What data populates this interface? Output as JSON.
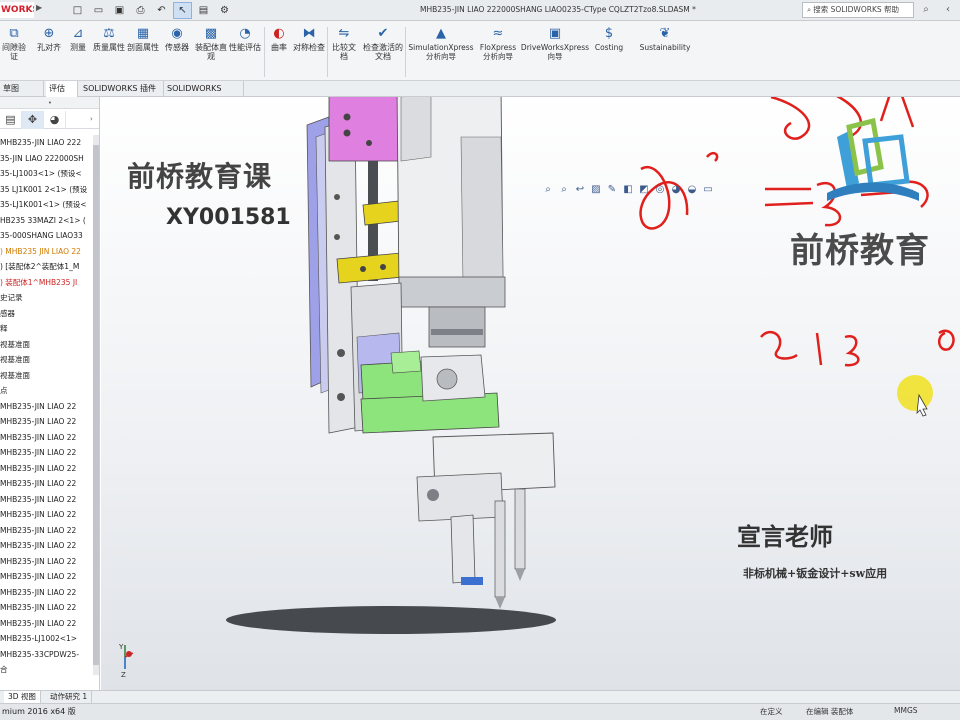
{
  "app": {
    "logo_text": "WORKS"
  },
  "title_bar": {
    "document_title": "MHB235-JIN LIAO 222000SHANG LIAO0235-CType CQLZT2Tzo8.SLDASM *",
    "help_search_placeholder": "搜索 SOLIDWORKS 帮助"
  },
  "quick_access": [
    "new-icon",
    "open-icon",
    "save-icon",
    "print-icon",
    "undo-icon",
    "select-icon",
    "file-properties-icon",
    "options-icon"
  ],
  "ribbon": {
    "buttons": [
      {
        "label": "间隙验证",
        "icon": "clearance-icon"
      },
      {
        "label": "孔对齐",
        "icon": "hole-align-icon"
      },
      {
        "label": "测量",
        "icon": "measure-icon"
      },
      {
        "label": "质量属性",
        "icon": "mass-properties-icon"
      },
      {
        "label": "剖面属性",
        "icon": "section-properties-icon"
      },
      {
        "label": "传感器",
        "icon": "sensor-icon"
      },
      {
        "label": "装配体直观",
        "icon": "assembly-visual-icon"
      },
      {
        "label": "性能评估",
        "icon": "performance-icon"
      },
      {
        "label": "曲率",
        "icon": "curvature-icon"
      },
      {
        "label": "对称检查",
        "icon": "symmetry-icon"
      },
      {
        "label": "比较文档",
        "icon": "compare-icon"
      },
      {
        "label": "检查激活的文档",
        "icon": "check-document-icon"
      },
      {
        "label": "SimulationXpress 分析向导",
        "icon": "simulation-icon"
      },
      {
        "label": "FloXpress 分析向导",
        "icon": "floxpress-icon"
      },
      {
        "label": "DriveWorksXpress 向导",
        "icon": "driveworks-icon"
      },
      {
        "label": "Costing",
        "icon": "costing-icon"
      },
      {
        "label": "Sustainability",
        "icon": "sustainability-icon"
      }
    ]
  },
  "command_tabs": [
    "草图",
    "评估",
    "SOLIDWORKS 插件",
    "SOLIDWORKS MBD"
  ],
  "feature_tree": {
    "items": [
      {
        "text": "MHB235-JIN LIAO 222",
        "style": "normal"
      },
      {
        "text": "35-JIN LIAO 222000SH",
        "style": "normal"
      },
      {
        "text": "35-LJ1003<1> (预设<",
        "style": "normal"
      },
      {
        "text": "35 LJ1K001 2<1> (预设",
        "style": "normal"
      },
      {
        "text": "35-LJ1K001<1> (预设<",
        "style": "normal"
      },
      {
        "text": "HB235 33MAZI 2<1> (",
        "style": "normal"
      },
      {
        "text": "35-000SHANG LIAO33",
        "style": "normal"
      },
      {
        "text": ") MHB235 JIN LIAO 22",
        "style": "orange"
      },
      {
        "text": ") [装配体2^装配体1_M",
        "style": "normal"
      },
      {
        "text": ") 装配体1^MHB235 JI",
        "style": "red"
      },
      {
        "text": "史记录",
        "style": "normal"
      },
      {
        "text": "感器",
        "style": "normal"
      },
      {
        "text": "释",
        "style": "normal"
      },
      {
        "text": "视基准面",
        "style": "normal"
      },
      {
        "text": "视基准面",
        "style": "normal"
      },
      {
        "text": "视基准面",
        "style": "normal"
      },
      {
        "text": "点",
        "style": "normal"
      },
      {
        "text": "MHB235-JIN LIAO 22",
        "style": "normal"
      },
      {
        "text": "MHB235-JIN LIAO 22",
        "style": "normal"
      },
      {
        "text": "MHB235-JIN LIAO 22",
        "style": "normal"
      },
      {
        "text": "MHB235-JIN LIAO 22",
        "style": "normal"
      },
      {
        "text": "MHB235-JIN LIAO 22",
        "style": "normal"
      },
      {
        "text": "MHB235-JIN LIAO 22",
        "style": "normal"
      },
      {
        "text": "MHB235-JIN LIAO 22",
        "style": "normal"
      },
      {
        "text": "MHB235-JIN LIAO 22",
        "style": "normal"
      },
      {
        "text": "MHB235-JIN LIAO 22",
        "style": "normal"
      },
      {
        "text": "MHB235-JIN LIAO 22",
        "style": "normal"
      },
      {
        "text": "MHB235-JIN LIAO 22",
        "style": "normal"
      },
      {
        "text": "MHB235-JIN LIAO 22",
        "style": "normal"
      },
      {
        "text": "MHB235-JIN LIAO 22",
        "style": "normal"
      },
      {
        "text": "MHB235-JIN LIAO 22",
        "style": "normal"
      },
      {
        "text": "MHB235-JIN LIAO 22",
        "style": "normal"
      },
      {
        "text": "MHB235-LJ1002<1>",
        "style": "normal"
      },
      {
        "text": "MHB235-33CPDW25-",
        "style": "normal"
      },
      {
        "text": "合",
        "style": "normal"
      }
    ]
  },
  "watermarks": {
    "line1": "前桥教育课",
    "line2": "XY001581",
    "brand": "前桥教育",
    "teacher": "宣言老师",
    "subtitle": "非标机械+钣金设计+sw应用"
  },
  "bottom_tabs": [
    "3D 视图",
    "动作研究 1"
  ],
  "status_bar": {
    "left": "mium 2016 x64 版",
    "middle_1": "在定义",
    "middle_2": "在编辑 装配体",
    "units": "MMGS"
  },
  "colors": {
    "ink_red": "#e0201c",
    "magenta_part": "#df7fdf",
    "yellow_part": "#e6d31e",
    "green_part": "#8ee47c",
    "lavender_part": "#9ea0e8",
    "logo_red": "#d4202c"
  }
}
